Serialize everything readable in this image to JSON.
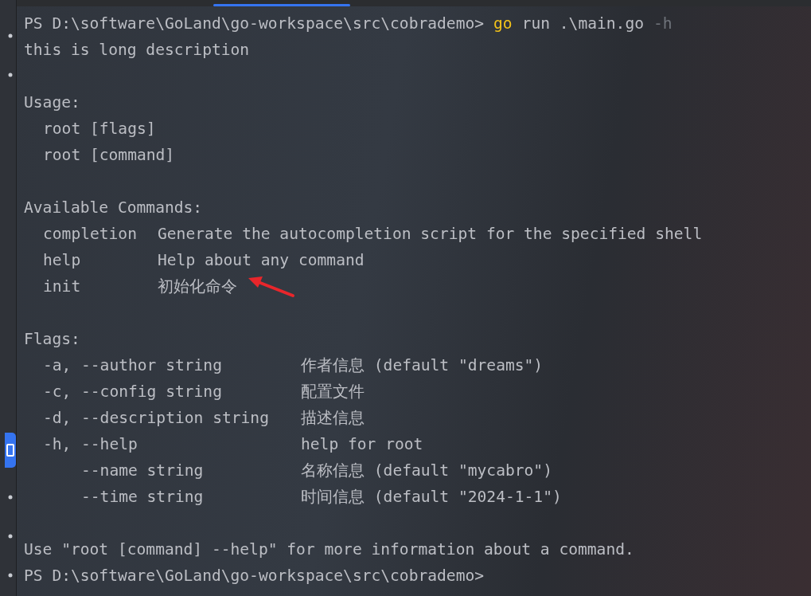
{
  "tool_strip": {
    "buttons": [
      {
        "selected": false
      },
      {
        "selected": false
      },
      {
        "selected": true
      },
      {
        "selected": false
      },
      {
        "selected": false
      },
      {
        "selected": false
      }
    ]
  },
  "terminal": {
    "lines": [
      {
        "kind": "prompt",
        "prompt": "PS D:\\software\\GoLand\\go-workspace\\src\\cobrademo>",
        "command": "go",
        "args": "run .\\main.go",
        "hint": "-h"
      },
      {
        "kind": "text",
        "text": "this is long description"
      },
      {
        "kind": "blank"
      },
      {
        "kind": "text",
        "text": "Usage:"
      },
      {
        "kind": "item",
        "text": "root [flags]"
      },
      {
        "kind": "item",
        "text": "root [command]"
      },
      {
        "kind": "blank"
      },
      {
        "kind": "text",
        "text": "Available Commands:"
      },
      {
        "kind": "command",
        "name": "completion",
        "description": "Generate the autocompletion script for the specified shell"
      },
      {
        "kind": "command",
        "name": "help",
        "description": "Help about any command"
      },
      {
        "kind": "command",
        "name": "init",
        "description": "初始化命令",
        "annotated": true
      },
      {
        "kind": "blank"
      },
      {
        "kind": "text",
        "text": "Flags:"
      },
      {
        "kind": "flag",
        "short": "-a,",
        "long": "--author string",
        "description": "作者信息 (default \"dreams\")"
      },
      {
        "kind": "flag",
        "short": "-c,",
        "long": "--config string",
        "description": "配置文件"
      },
      {
        "kind": "flag",
        "short": "-d,",
        "long": "--description string",
        "description": "描述信息"
      },
      {
        "kind": "flag",
        "short": "-h,",
        "long": "--help",
        "description": "help for root"
      },
      {
        "kind": "flag",
        "long": "--name string",
        "description": "名称信息 (default \"mycabro\")"
      },
      {
        "kind": "flag",
        "long": "--time string",
        "description": "时间信息 (default \"2024-1-1\")"
      },
      {
        "kind": "blank"
      },
      {
        "kind": "text",
        "text": "Use \"root [command] --help\" for more information about a command."
      },
      {
        "kind": "prompt",
        "prompt": "PS D:\\software\\GoLand\\go-workspace\\src\\cobrademo>"
      }
    ]
  }
}
